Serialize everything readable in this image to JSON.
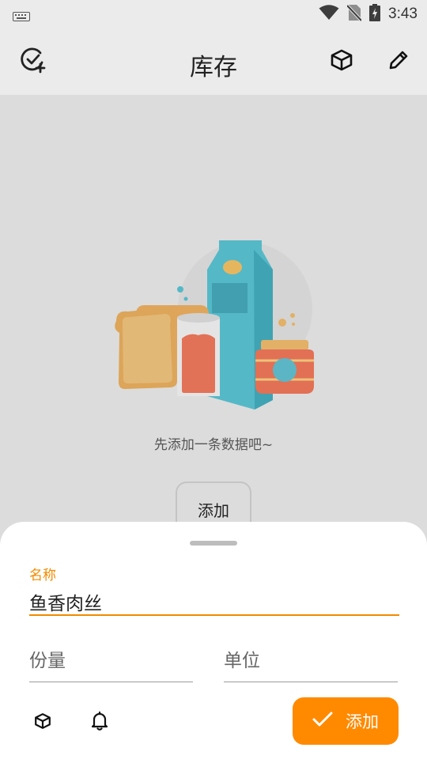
{
  "status_bar": {
    "time": "3:43",
    "icons": [
      "keyboard-icon",
      "wifi-icon",
      "no-sim-icon",
      "battery-charging-icon"
    ]
  },
  "app_bar": {
    "title": "库存",
    "icons": [
      "check-add-icon",
      "box-icon",
      "edit-icon"
    ]
  },
  "empty_state": {
    "message": "先添加一条数据吧~",
    "add_label": "添加"
  },
  "sheet": {
    "name_label": "名称",
    "name_value": "鱼香肉丝",
    "quantity_placeholder": "份量",
    "unit_placeholder": "单位",
    "submit_label": "添加",
    "icons": [
      "box-icon",
      "bell-icon",
      "check-icon"
    ]
  },
  "colors": {
    "accent": "#ff8a00",
    "background": "#dcdcdc",
    "sheet": "#ffffff"
  }
}
